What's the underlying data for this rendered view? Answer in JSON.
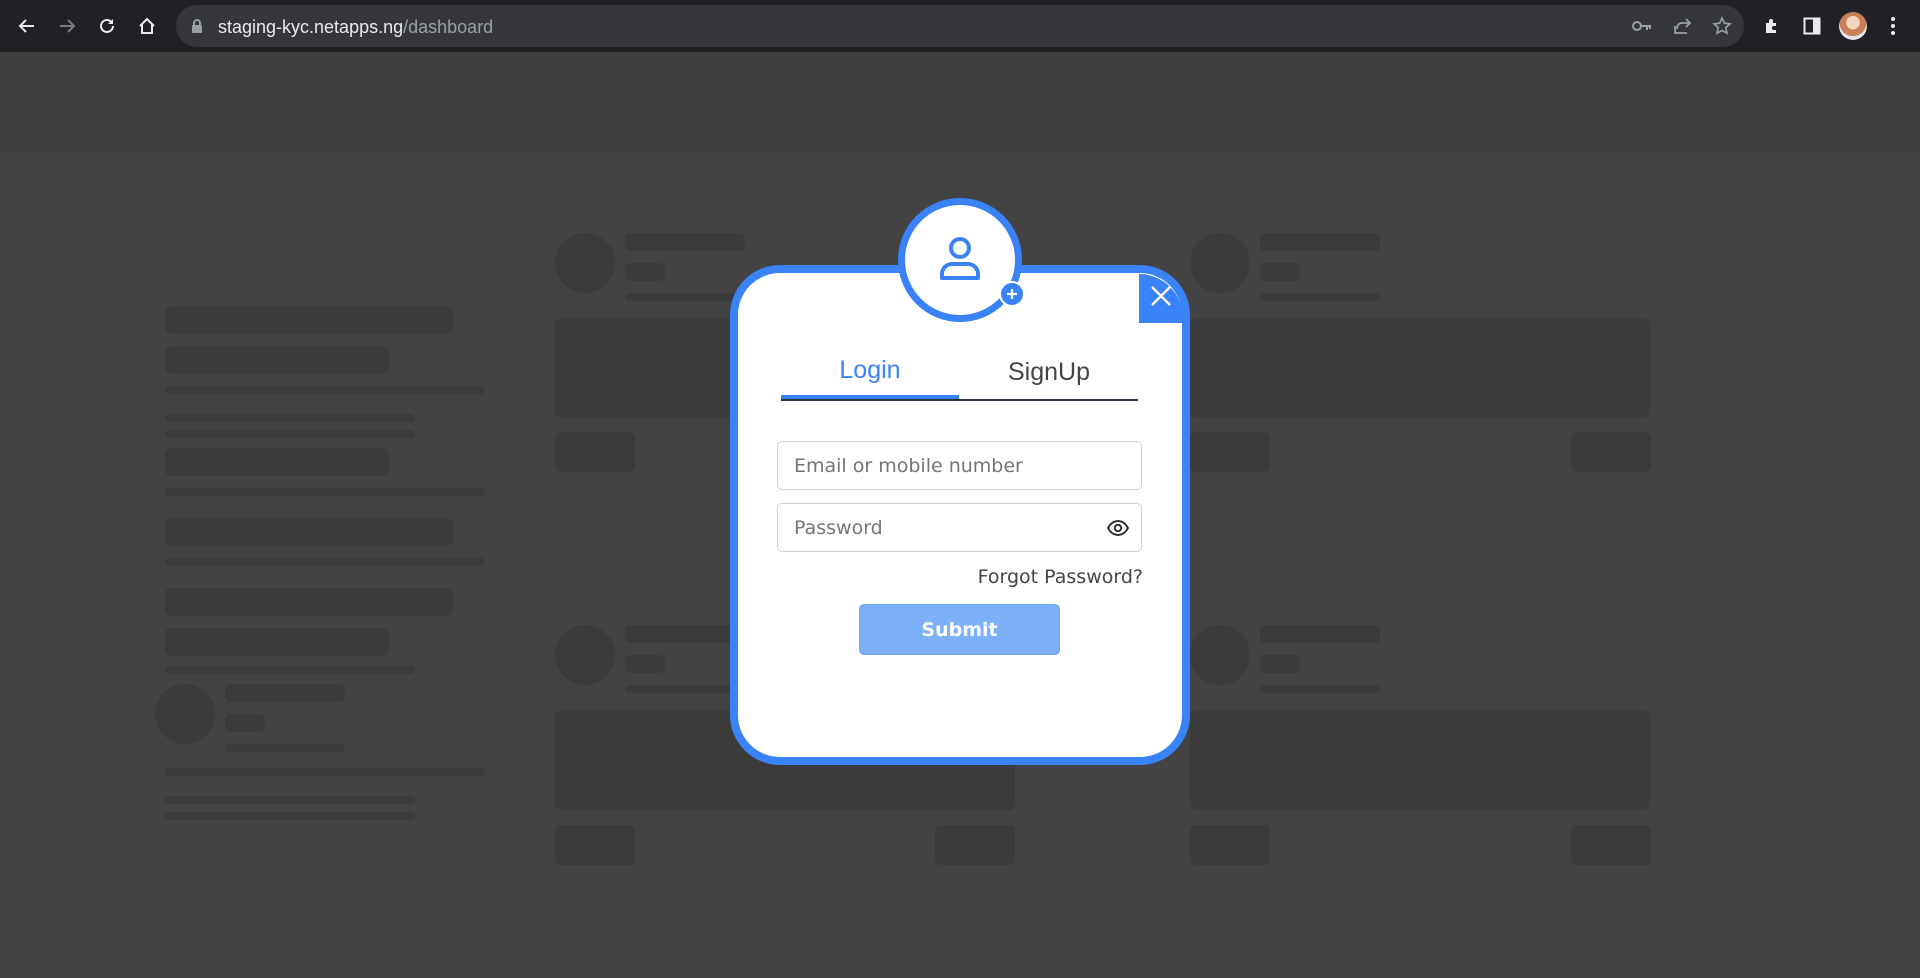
{
  "browser": {
    "url_host": "staging-kyc.netapps.ng",
    "url_path": "/dashboard",
    "icons": [
      "back-icon",
      "forward-icon",
      "reload-icon",
      "home-icon",
      "lock-icon",
      "key-icon",
      "share-icon",
      "star-icon",
      "extensions-icon",
      "side-panel-icon",
      "profile-avatar",
      "menu-icon"
    ]
  },
  "modal": {
    "tabs": [
      {
        "label": "Login",
        "active": true
      },
      {
        "label": "SignUp",
        "active": false
      }
    ],
    "email_placeholder": "Email or mobile number",
    "password_placeholder": "Password",
    "forgot_label": "Forgot Password?",
    "submit_label": "Submit"
  },
  "colors": {
    "accent": "#3a82f7",
    "submit_bg": "#7cb1fa",
    "overlay": "#434343",
    "chrome": "#202124"
  }
}
